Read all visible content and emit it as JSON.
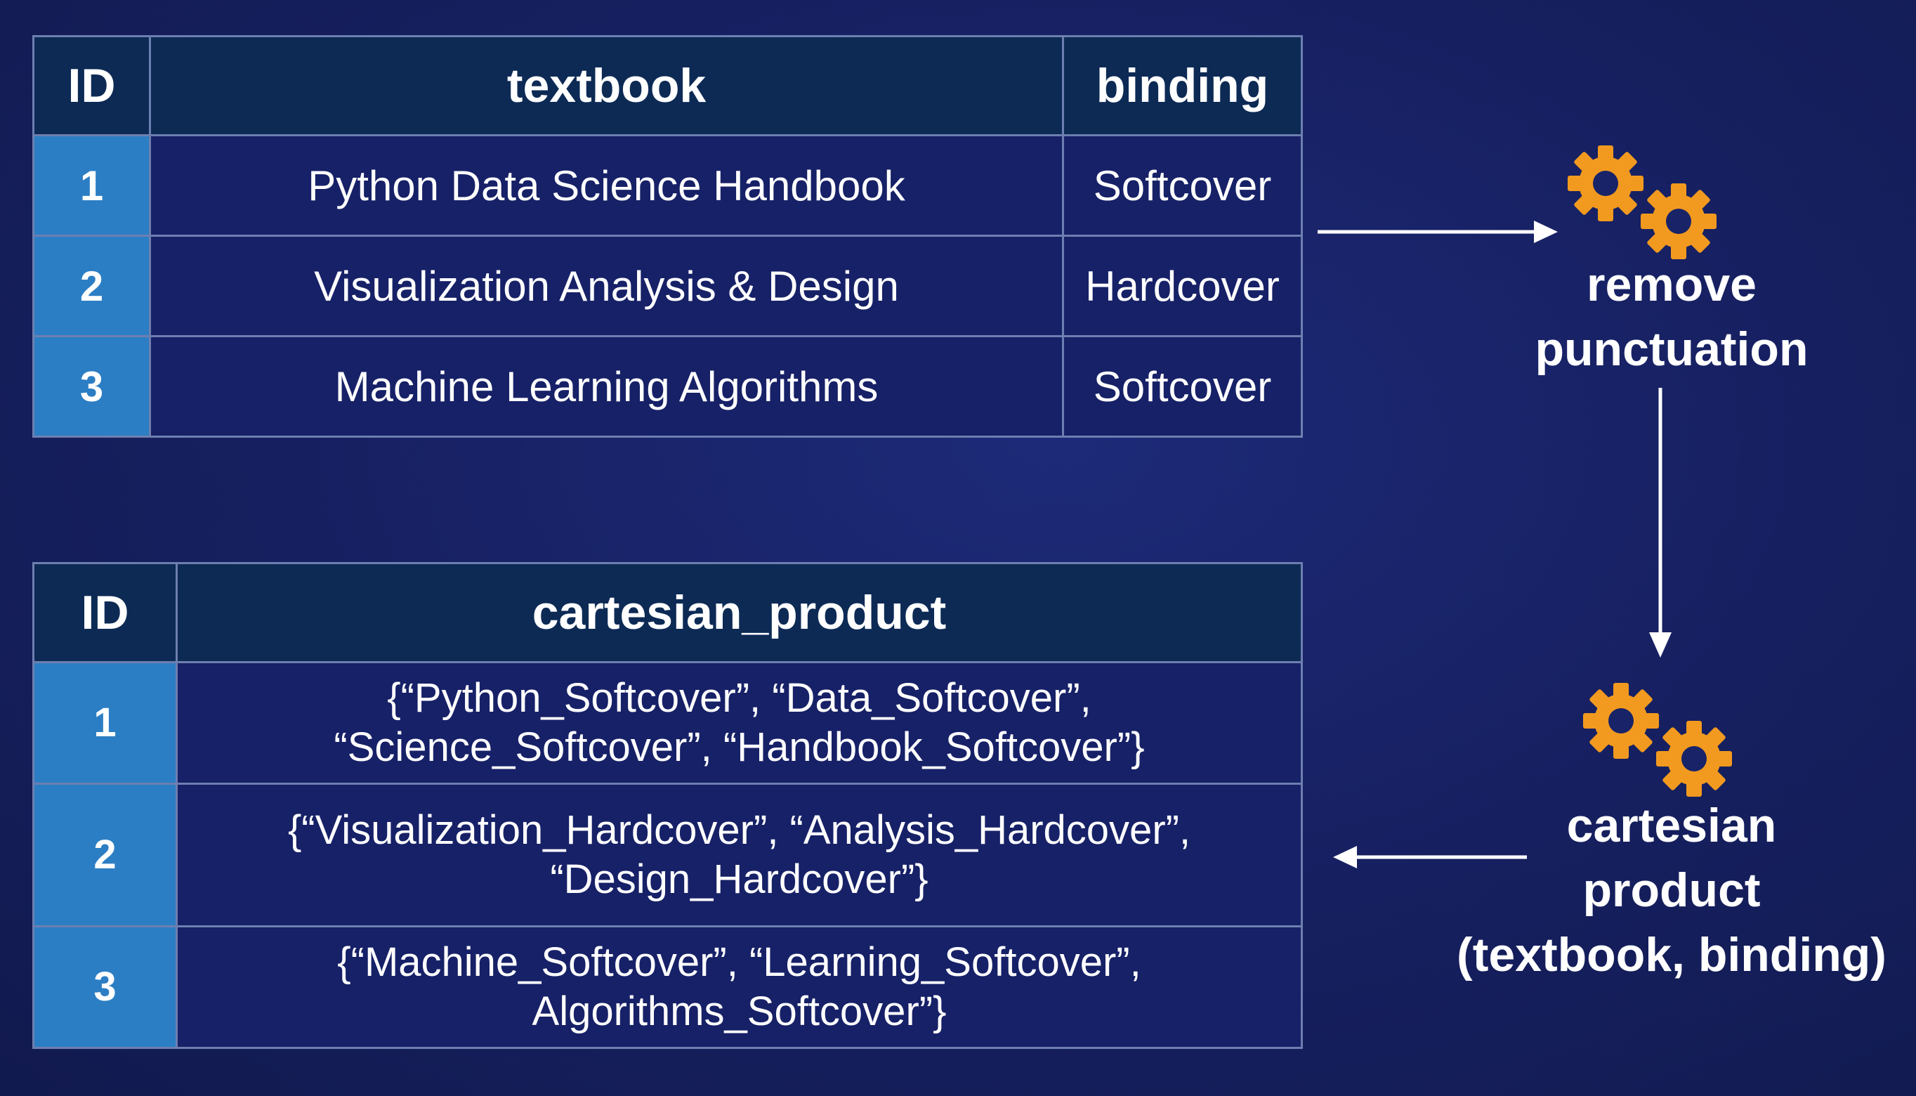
{
  "source_table": {
    "headers": [
      "ID",
      "textbook",
      "binding"
    ],
    "rows": [
      {
        "id": "1",
        "textbook": "Python Data Science Handbook",
        "binding": "Softcover"
      },
      {
        "id": "2",
        "textbook": "Visualization Analysis & Design",
        "binding": "Hardcover"
      },
      {
        "id": "3",
        "textbook": "Machine Learning Algorithms",
        "binding": "Softcover"
      }
    ]
  },
  "steps": {
    "remove_punctuation": {
      "line1": "remove",
      "line2": "punctuation",
      "icon": "gears-icon"
    },
    "cartesian_product": {
      "line1": "cartesian",
      "line2": "product",
      "line3": "(textbook, binding)",
      "icon": "gears-icon"
    }
  },
  "result_table": {
    "headers": [
      "ID",
      "cartesian_product"
    ],
    "rows": [
      {
        "id": "1",
        "lines": [
          "{“Python_Softcover”, “Data_Softcover”,",
          "“Science_Softcover”, “Handbook_Softcover”}"
        ]
      },
      {
        "id": "2",
        "lines": [
          "{“Visualization_Hardcover”, “Analysis_Hardcover”,",
          "“Design_Hardcover”}"
        ]
      },
      {
        "id": "3",
        "lines": [
          "{“Machine_Softcover”, “Learning_Softcover”,",
          "Algorithms_Softcover”}"
        ]
      }
    ]
  },
  "colors": {
    "background": "#172163",
    "header_fill": "#0d2a55",
    "id_fill": "#2c7ec4",
    "body_fill": "#172167",
    "border": "#6d7fb0",
    "gear": "#f29a1f",
    "arrow": "#ffffff"
  }
}
